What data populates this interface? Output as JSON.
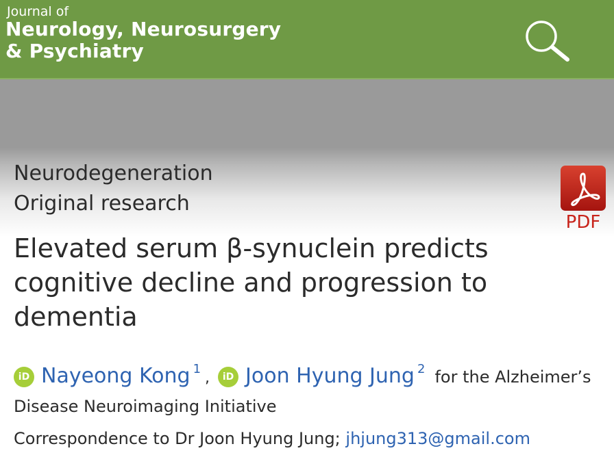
{
  "header": {
    "journal_prefix": "Journal of",
    "journal_name_line1": "Neurology, Neurosurgery",
    "journal_name_line2": "& Psychiatry",
    "search_icon": "search-icon",
    "brand_color": "#6f9a45"
  },
  "article": {
    "section": "Neurodegeneration",
    "type": "Original research",
    "title": "Elevated serum β-synuclein predicts cognitive decline and progression to dementia",
    "pdf_label": "PDF",
    "pdf_icon": "adobe-pdf-icon",
    "authors": [
      {
        "name": "Nayeong Kong",
        "affiliation": "1",
        "icon": "orcid-icon"
      },
      {
        "name": "Joon Hyung Jung",
        "affiliation": "2",
        "icon": "orcid-icon"
      }
    ],
    "orcid_label": "iD",
    "author_separator": ",",
    "group_prefix": "for the Alzheimer’s",
    "group_suffix": "Disease Neuroimaging Initiative",
    "correspondence_text": "Correspondence to Dr Joon Hyung Jung;",
    "correspondence_email": "jhjung313@gmail.com",
    "link_color": "#2e63b1"
  }
}
